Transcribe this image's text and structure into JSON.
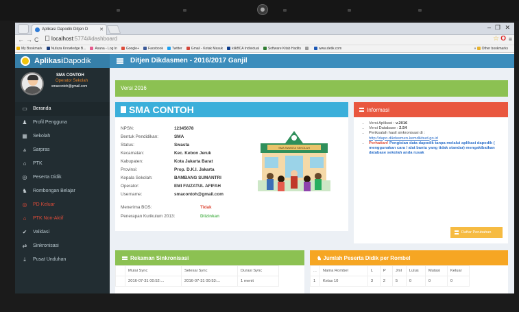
{
  "browser": {
    "tab_title": "Aplikasi Dapodik Ditjen D",
    "url_host": "localhost",
    "url_path": ":5774/#dashboard",
    "bookmarks": [
      {
        "label": "My Bookmark",
        "color": "#f0b400"
      },
      {
        "label": "Nufaza Knowledge B...",
        "color": "#1a3d7c"
      },
      {
        "label": "Asana - Log In",
        "color": "#e65a8d"
      },
      {
        "label": "Google+",
        "color": "#dd4b39"
      },
      {
        "label": "Facebook",
        "color": "#3b5998"
      },
      {
        "label": "Twitter",
        "color": "#1da1f2"
      },
      {
        "label": "Gmail - Kotak Masuk",
        "color": "#d44638"
      },
      {
        "label": "klikBCA Individual",
        "color": "#0b3c8c"
      },
      {
        "label": "Software Kitab Hadits",
        "color": "#2f7d32"
      },
      {
        "label": "",
        "color": "#999999"
      },
      {
        "label": "www.detik.com",
        "color": "#1b57b5"
      }
    ],
    "other_bookmarks": "Other bookmarks"
  },
  "app": {
    "logo_bold": "Aplikasi",
    "logo_rest": "Dapodik",
    "header_title": "Ditjen Dikdasmen - 2016/2017 Ganjil",
    "user": {
      "name": "SMA CONTOH",
      "role": "Operator Sekolah",
      "email": "smacontoh@gmail.com"
    },
    "menu": [
      {
        "label": "Beranda",
        "icon": "desktop-icon",
        "glyph": "▭",
        "active": true,
        "red": false
      },
      {
        "label": "Profil Pengguna",
        "icon": "user-icon",
        "glyph": "♟",
        "active": false,
        "red": false
      },
      {
        "label": "Sekolah",
        "icon": "building-icon",
        "glyph": "▦",
        "active": false,
        "red": false
      },
      {
        "label": "Sarpras",
        "icon": "road-icon",
        "glyph": "⩓",
        "active": false,
        "red": false
      },
      {
        "label": "PTK",
        "icon": "mortarboard-icon",
        "glyph": "⌂",
        "active": false,
        "red": false
      },
      {
        "label": "Peserta Didik",
        "icon": "globe-icon",
        "glyph": "◎",
        "active": false,
        "red": false
      },
      {
        "label": "Rombongan Belajar",
        "icon": "group-icon",
        "glyph": "♞",
        "active": false,
        "red": false
      },
      {
        "label": "PD Keluar",
        "icon": "globe-icon",
        "glyph": "◎",
        "active": false,
        "red": true
      },
      {
        "label": "PTK Non-Aktif",
        "icon": "mortarboard-icon",
        "glyph": "⌂",
        "active": false,
        "red": true
      },
      {
        "label": "Validasi",
        "icon": "check-icon",
        "glyph": "✔",
        "active": false,
        "red": false
      },
      {
        "label": "Sinkronisasi",
        "icon": "exchange-icon",
        "glyph": "⇄",
        "active": false,
        "red": false
      },
      {
        "label": "Pusat Unduhan",
        "icon": "download-icon",
        "glyph": "⤓",
        "active": false,
        "red": false
      }
    ],
    "version_banner": "Versi 2016",
    "school": {
      "title": "SMA CONTOH",
      "fields": [
        {
          "k": "NPSN:",
          "v": "12345678",
          "cls": ""
        },
        {
          "k": "Bentuk Pendidikan:",
          "v": "SMA",
          "cls": ""
        },
        {
          "k": "Status:",
          "v": "Swasta",
          "cls": ""
        },
        {
          "k": "Kecamatan:",
          "v": "Kec. Kebon Jeruk",
          "cls": ""
        },
        {
          "k": "Kabupaten:",
          "v": "Kota Jakarta Barat",
          "cls": ""
        },
        {
          "k": "Provinsi:",
          "v": "Prop. D.K.I. Jakarta",
          "cls": ""
        },
        {
          "k": "Kepala Sekolah:",
          "v": "BAMBANG SUMANTRI",
          "cls": ""
        },
        {
          "k": "Operator:",
          "v": "EMI FAIZATUL AFIFAH",
          "cls": ""
        },
        {
          "k": "Username:",
          "v": "smacontoh@gmail.com",
          "cls": ""
        }
      ],
      "bos_label": "Menerima BOS:",
      "bos_value": "Tidak",
      "kurikulum_label": "Penerapan Kurikulum 2013:",
      "kurikulum_value": "Diizinkan",
      "sign_text": "SMA SWASTA SEKOLAH"
    },
    "info": {
      "title": "Informasi",
      "versi_aplikasi_label": "Versi Aplikasi : ",
      "versi_aplikasi": "v.2016",
      "versi_db_label": "Versi Database : ",
      "versi_db": "2.54",
      "sync_label": "Periksalah hasil sinkronisasi di :",
      "sync_link": "http://dapo.dikdasmen.kemdikbud.go.id",
      "warn_label": "Perhatian!",
      "warn_text": " Pengisian data dapodik tanpa melalui aplikasi dapodik ( menggunakan cara / alat bantu yang tidak standar) mengakibatkan database sekolah anda rusak",
      "button": "Daftar Perubahan"
    },
    "sync": {
      "title": "Rekaman Sinkronisasi",
      "columns": [
        "",
        "Mulai Sync",
        "Selesai Sync",
        "Durasi Sync"
      ],
      "rows": [
        [
          "",
          "2016-07-31 00:52:...",
          "2016-07-31 00:53:...",
          "1 menit"
        ]
      ]
    },
    "rombel": {
      "title": "Jumlah Peserta Didik per Rombel",
      "columns": [
        "...",
        "Nama Rombel",
        "L",
        "P",
        "Jml",
        "Lulus",
        "Mutasi",
        "Keluar"
      ],
      "rows": [
        [
          "1",
          "Kelas 10",
          "3",
          "2",
          "5",
          "0",
          "0",
          "0"
        ]
      ]
    }
  }
}
